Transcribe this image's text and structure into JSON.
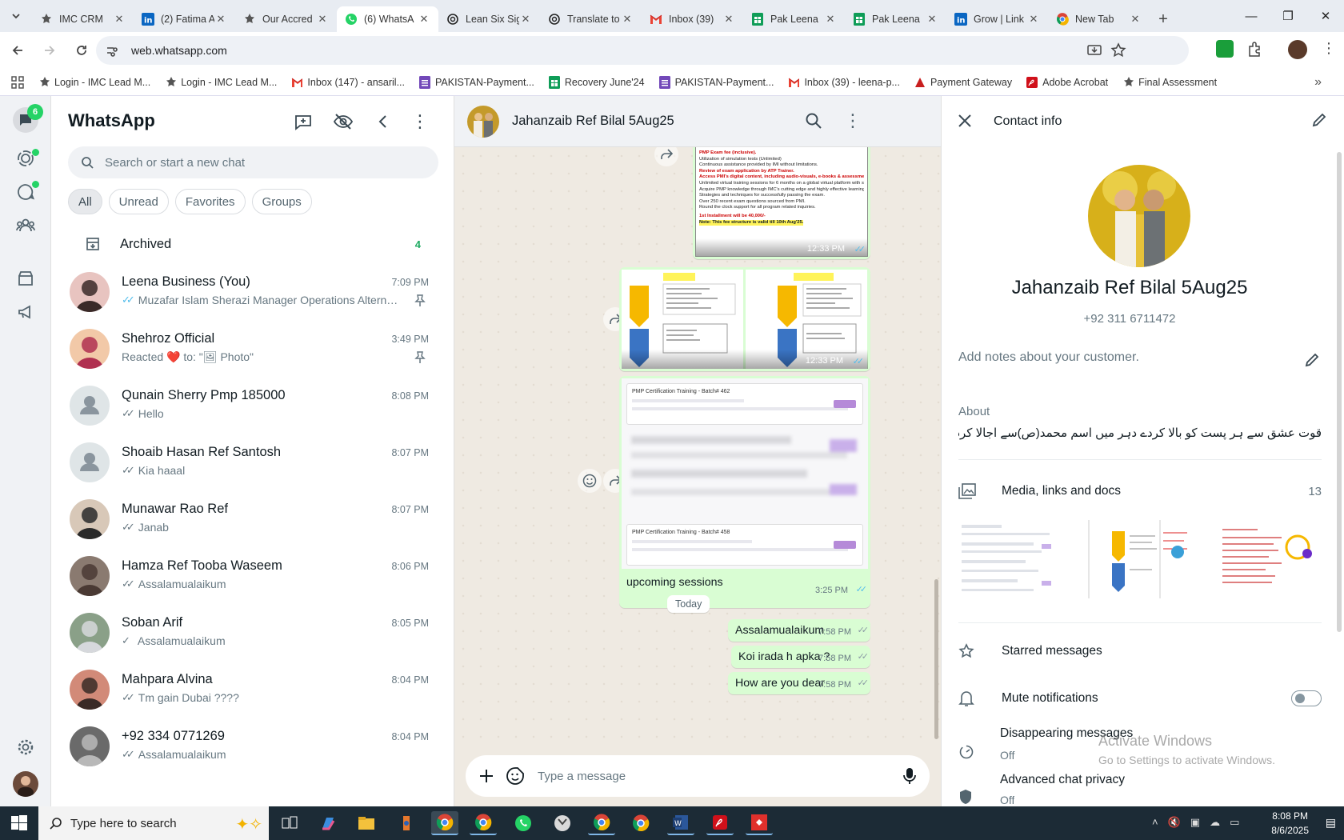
{
  "browser": {
    "tabs": [
      {
        "title": "IMC CRM",
        "icon": "imc-icon",
        "active": false
      },
      {
        "title": "(2) Fatima A",
        "icon": "linkedin-icon",
        "active": false
      },
      {
        "title": "Our Accred",
        "icon": "imc-icon",
        "active": false
      },
      {
        "title": "(6) WhatsA",
        "icon": "whatsapp-icon",
        "active": true
      },
      {
        "title": "Lean Six Sig",
        "icon": "openai-icon",
        "active": false
      },
      {
        "title": "Translate to",
        "icon": "openai-icon",
        "active": false
      },
      {
        "title": "Inbox (39)",
        "icon": "gmail-icon",
        "active": false
      },
      {
        "title": "Pak Leena",
        "icon": "sheets-icon",
        "active": false
      },
      {
        "title": "Pak Leena",
        "icon": "sheets-icon",
        "active": false
      },
      {
        "title": "Grow | Link",
        "icon": "linkedin-icon",
        "active": false
      },
      {
        "title": "New Tab",
        "icon": "chrome-icon",
        "active": false
      }
    ],
    "url": "web.whatsapp.com",
    "bookmarks": [
      {
        "label": "Login - IMC Lead M...",
        "icon": "imc-icon"
      },
      {
        "label": "Login - IMC Lead M...",
        "icon": "imc-icon"
      },
      {
        "label": "Inbox (147) - ansaril...",
        "icon": "gmail-icon"
      },
      {
        "label": "PAKISTAN-Payment...",
        "icon": "forms-icon"
      },
      {
        "label": "Recovery June'24",
        "icon": "sheets-icon"
      },
      {
        "label": "PAKISTAN-Payment...",
        "icon": "forms-icon"
      },
      {
        "label": "Inbox (39) - leena-p...",
        "icon": "gmail-icon"
      },
      {
        "label": "Payment Gateway",
        "icon": "payment-icon"
      },
      {
        "label": "Adobe Acrobat",
        "icon": "acrobat-icon"
      },
      {
        "label": "Final Assessment",
        "icon": "imc-icon"
      }
    ]
  },
  "rail": {
    "chats_badge": "6"
  },
  "chatlist": {
    "title": "WhatsApp",
    "search_placeholder": "Search or start a new chat",
    "filters": [
      "All",
      "Unread",
      "Favorites",
      "Groups"
    ],
    "archived_label": "Archived",
    "archived_count": "4",
    "chats": [
      {
        "name": "Leena Business (You)",
        "time": "7:09 PM",
        "preview": "Muzafar Islam Sherazi Manager Operations Alternati...",
        "tick": "blue-double",
        "pinned": true
      },
      {
        "name": "Shehroz Official",
        "time": "3:49 PM",
        "preview": "Reacted ❤️ to: \"🖼 Photo\"",
        "tick": "none",
        "pinned": true
      },
      {
        "name": "Qunain Sherry Pmp 185000",
        "time": "8:08 PM",
        "preview": "Hello",
        "tick": "grey-double",
        "pinned": false
      },
      {
        "name": "Shoaib Hasan Ref Santosh",
        "time": "8:07 PM",
        "preview": "Kia haaal",
        "tick": "grey-double",
        "pinned": false
      },
      {
        "name": "Munawar Rao Ref",
        "time": "8:07 PM",
        "preview": "Janab",
        "tick": "grey-double",
        "pinned": false
      },
      {
        "name": "Hamza Ref Tooba Waseem",
        "time": "8:06 PM",
        "preview": "Assalamualaikum",
        "tick": "grey-double",
        "pinned": false
      },
      {
        "name": "Soban Arif",
        "time": "8:05 PM",
        "preview": "Assalamualaikum",
        "tick": "grey-single",
        "pinned": false
      },
      {
        "name": "Mahpara Alvina",
        "time": "8:04 PM",
        "preview": "Tm gain Dubai ????",
        "tick": "grey-double",
        "pinned": false
      },
      {
        "name": "+92 334 0771269",
        "time": "8:04 PM",
        "preview": "Assalamualaikum",
        "tick": "grey-double",
        "pinned": false
      }
    ]
  },
  "conversation": {
    "contact_name": "Jahanzaib Ref Bilal 5Aug25",
    "image_bubbles": [
      {
        "time": "12:33 PM",
        "caption_lines": [
          "PMP Exam fee (inclusive).",
          "Utilization of simulation tests (Unlimited)",
          "Continuous assistance provided by IMI without limitations.",
          "Review of exam application by ATP Trainer.",
          "Access PMI's digital content, including audio-visuals, e-books & assessments",
          "Unlimited virtual training sessions for 6 months on a global virtual platform with students worldwide.",
          "Acquire PMP knowledge through IMC's cutting edge and highly effective learning approach.",
          "Strategies and techniques for successfully passing the exam.",
          "Over 250 recent exam questions sourced from PMI.",
          "Round the clock support for all program related inquiries."
        ],
        "installment": "1st Installment will be 40,000/-",
        "note": "Note: This fee structure is valid till 10th Aug'25."
      },
      {
        "time": "12:33 PM"
      },
      {
        "caption": "upcoming sessions",
        "time": "3:25 PM",
        "batch_a": "PMP Certification Training - Batch# 462",
        "batch_b": "PMP Certification Training - Batch# 458"
      }
    ],
    "day_chip": "Today",
    "messages": [
      {
        "text": "Assalamualaikum",
        "time": "7:58 PM"
      },
      {
        "text": "Koi irada h apka ?",
        "time": "7:58 PM"
      },
      {
        "text": "How are you dear",
        "time": "7:58 PM"
      }
    ],
    "composer_placeholder": "Type a message"
  },
  "contact_info": {
    "title": "Contact info",
    "name": "Jahanzaib Ref Bilal 5Aug25",
    "phone": "+92 311 6711472",
    "notes_placeholder": "Add notes about your customer.",
    "about_label": "About",
    "about_text": "قوت عشق سے ہر پست کو بالا کردے دہر میں اسم محمد(ص)سے اجالا کردے",
    "media_label": "Media, links and docs",
    "media_count": "13",
    "starred_label": "Starred messages",
    "mute_label": "Mute notifications",
    "disappearing_label": "Disappearing messages",
    "disappearing_value": "Off",
    "privacy_label": "Advanced chat privacy",
    "privacy_value": "Off",
    "activate_title": "Activate Windows",
    "activate_sub": "Go to Settings to activate Windows."
  },
  "taskbar": {
    "search_placeholder": "Type here to search",
    "time": "8:08 PM",
    "date": "8/6/2025"
  },
  "colors": {
    "accent_green": "#25d366",
    "bubble_green": "#d9fdd3",
    "read_tick": "#53bdeb",
    "chat_bg": "#efeae2"
  }
}
